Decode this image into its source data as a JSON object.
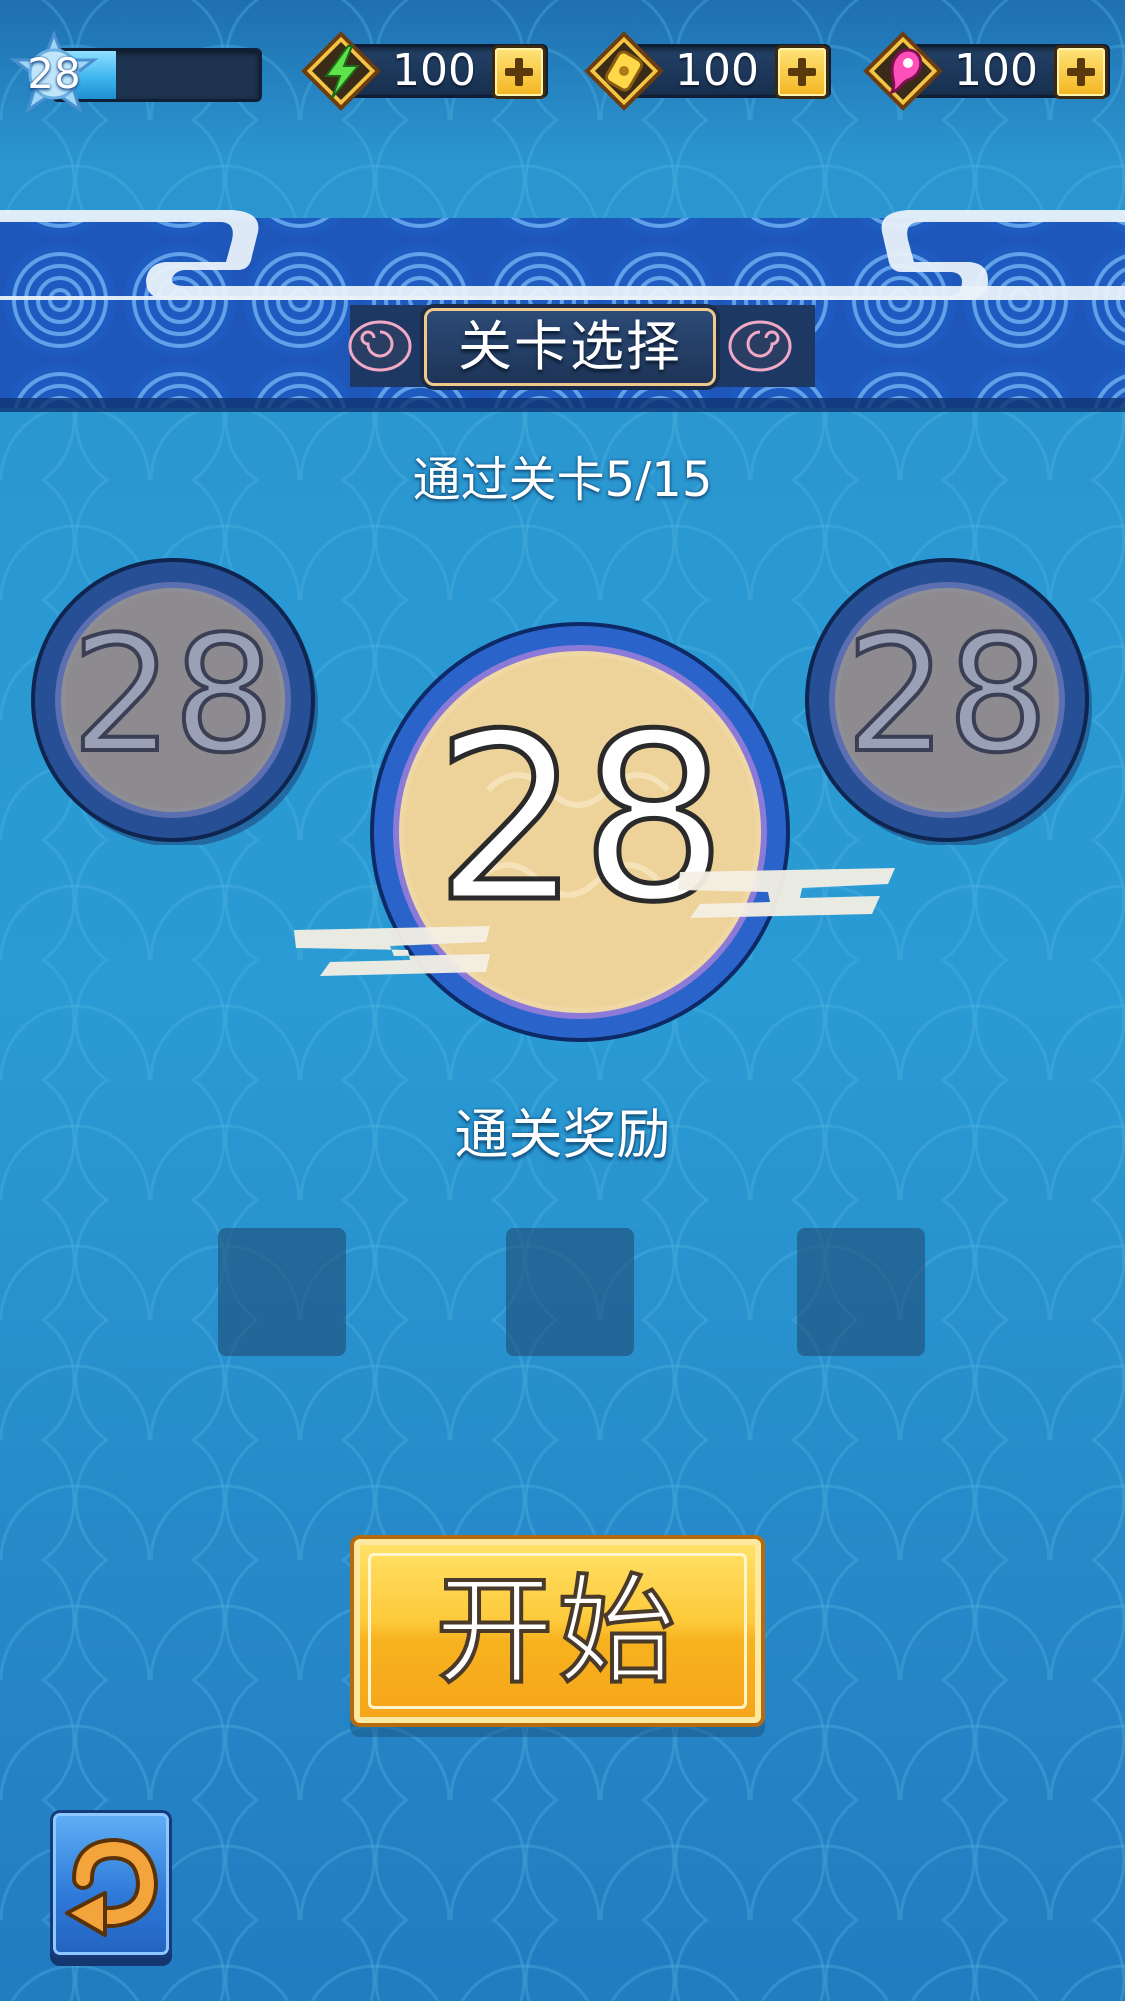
{
  "topbar": {
    "level": "28",
    "level_progress": 0.3,
    "resources": [
      {
        "name": "energy",
        "icon": "lightning-icon",
        "value": "100"
      },
      {
        "name": "gold",
        "icon": "gold-ingot-icon",
        "value": "100"
      },
      {
        "name": "gem",
        "icon": "magatama-icon",
        "value": "100"
      }
    ]
  },
  "banner": {
    "title": "关卡选择"
  },
  "progress": {
    "text": "通过关卡5/15"
  },
  "levels": {
    "prev": "28",
    "current": "28",
    "next": "28"
  },
  "rewards": {
    "title": "通关奖励",
    "slots": 3
  },
  "start_button": {
    "label": "开始"
  },
  "colors": {
    "background": "#2a97d1",
    "accent": "#f7b21f",
    "banner_blue": "#1f5fc5"
  }
}
